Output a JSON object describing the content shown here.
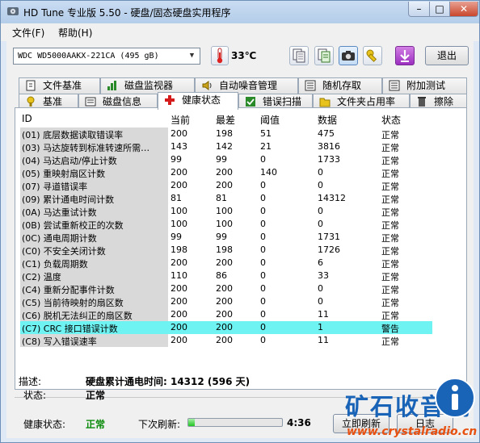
{
  "window": {
    "title": "HD Tune 专业版 5.50 - 硬盘/固态硬盘实用程序",
    "controls": {
      "minimize": "–",
      "maximize": "□",
      "close": "✕"
    }
  },
  "menu": [
    {
      "label": "文件(F)"
    },
    {
      "label": "帮助(H)"
    }
  ],
  "toolbar": {
    "drive": "WDC WD5000AAKX-221CA (495 gB)",
    "temperature": "33℃",
    "exit_label": "退出"
  },
  "tabs_top": [
    {
      "label": "文件基准",
      "icon": "file-benchmark-icon"
    },
    {
      "label": "磁盘监视器",
      "icon": "disk-monitor-icon"
    },
    {
      "label": "自动噪音管理",
      "icon": "speaker-icon"
    },
    {
      "label": "随机存取",
      "icon": "random-access-icon"
    },
    {
      "label": "附加测试",
      "icon": "extra-tests-icon"
    }
  ],
  "tabs_bottom": [
    {
      "label": "基准",
      "icon": "benchmark-icon"
    },
    {
      "label": "磁盘信息",
      "icon": "disk-info-icon"
    },
    {
      "label": "健康状态",
      "icon": "health-cross-icon",
      "active": true
    },
    {
      "label": "错误扫描",
      "icon": "error-scan-icon"
    },
    {
      "label": "文件夹占用率",
      "icon": "folder-usage-icon"
    },
    {
      "label": "擦除",
      "icon": "erase-icon"
    }
  ],
  "columns": [
    "ID",
    "当前",
    "最差",
    "阈值",
    "数据",
    "状态"
  ],
  "rows": [
    {
      "id": "(01) 底层数据读取错误率",
      "current": "200",
      "worst": "198",
      "threshold": "51",
      "data": "475",
      "status": "正常"
    },
    {
      "id": "(03) 马达旋转到标准转速所需…",
      "current": "143",
      "worst": "142",
      "threshold": "21",
      "data": "3816",
      "status": "正常"
    },
    {
      "id": "(04) 马达启动/停止计数",
      "current": "99",
      "worst": "99",
      "threshold": "0",
      "data": "1733",
      "status": "正常"
    },
    {
      "id": "(05) 重映射扇区计数",
      "current": "200",
      "worst": "200",
      "threshold": "140",
      "data": "0",
      "status": "正常"
    },
    {
      "id": "(07) 寻道错误率",
      "current": "200",
      "worst": "200",
      "threshold": "0",
      "data": "0",
      "status": "正常"
    },
    {
      "id": "(09) 累计通电时间计数",
      "current": "81",
      "worst": "81",
      "threshold": "0",
      "data": "14312",
      "status": "正常"
    },
    {
      "id": "(0A) 马达重试计数",
      "current": "100",
      "worst": "100",
      "threshold": "0",
      "data": "0",
      "status": "正常"
    },
    {
      "id": "(0B) 尝试重新校正的次数",
      "current": "100",
      "worst": "100",
      "threshold": "0",
      "data": "0",
      "status": "正常"
    },
    {
      "id": "(0C) 通电周期计数",
      "current": "99",
      "worst": "99",
      "threshold": "0",
      "data": "1731",
      "status": "正常"
    },
    {
      "id": "(C0) 不安全关闭计数",
      "current": "198",
      "worst": "198",
      "threshold": "0",
      "data": "1726",
      "status": "正常"
    },
    {
      "id": "(C1) 负载周期数",
      "current": "200",
      "worst": "200",
      "threshold": "0",
      "data": "6",
      "status": "正常"
    },
    {
      "id": "(C2) 温度",
      "current": "110",
      "worst": "86",
      "threshold": "0",
      "data": "33",
      "status": "正常"
    },
    {
      "id": "(C4) 重新分配事件计数",
      "current": "200",
      "worst": "200",
      "threshold": "0",
      "data": "0",
      "status": "正常"
    },
    {
      "id": "(C5) 当前待映射的扇区数",
      "current": "200",
      "worst": "200",
      "threshold": "0",
      "data": "0",
      "status": "正常"
    },
    {
      "id": "(C6) 脱机无法纠正的扇区数",
      "current": "200",
      "worst": "200",
      "threshold": "0",
      "data": "11",
      "status": "正常"
    },
    {
      "id": "(C7) CRC 接口错误计数",
      "current": "200",
      "worst": "200",
      "threshold": "0",
      "data": "1",
      "status": "警告",
      "warn": true
    },
    {
      "id": "(C8) 写入错误速率",
      "current": "200",
      "worst": "200",
      "threshold": "0",
      "data": "11",
      "status": "正常"
    }
  ],
  "details": {
    "desc_label": "描述:",
    "desc_value": "硬盘累计通电时间: 14312 (596 天)",
    "status_label": "状态:",
    "status_value": "正常"
  },
  "footer": {
    "health_label": "健康状态:",
    "health_value": "正常",
    "next_refresh_label": "下次刷新:",
    "refresh_progress_fraction": 0.07,
    "countdown": "4:36",
    "refresh_button": "立即刷新",
    "log_button": "日志"
  },
  "watermark": {
    "text_cn": "矿石收音机",
    "url": "www.crystalradio.cn"
  },
  "colors": {
    "warn_row": "#6ef2f2",
    "health_ok": "#0a8a0a",
    "watermark_blue": "#1a64b8",
    "watermark_orange": "#e85010"
  }
}
